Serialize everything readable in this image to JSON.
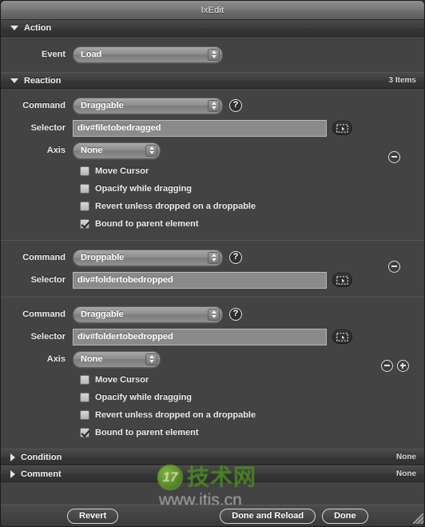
{
  "window": {
    "title": "IxEdit"
  },
  "sections": {
    "action": {
      "title": "Action",
      "disclosure": "down",
      "event_label": "Event",
      "event_value": "Load"
    },
    "reaction": {
      "title": "Reaction",
      "disclosure": "down",
      "count_label": "3 Items",
      "labels": {
        "command": "Command",
        "selector": "Selector",
        "axis": "Axis"
      },
      "items": [
        {
          "command": "Draggable",
          "selector": "div#filetobedragged",
          "axis": "None",
          "checkboxes": [
            {
              "label": "Move Cursor",
              "checked": false
            },
            {
              "label": "Opacify while dragging",
              "checked": false
            },
            {
              "label": "Revert unless dropped on a droppable",
              "checked": false
            },
            {
              "label": "Bound to parent element",
              "checked": true
            }
          ],
          "buttons": [
            "minus"
          ]
        },
        {
          "command": "Droppable",
          "selector": "div#foldertobedropped",
          "axis": null,
          "checkboxes": [],
          "buttons": [
            "minus"
          ]
        },
        {
          "command": "Draggable",
          "selector": "div#foldertobedropped",
          "axis": "None",
          "checkboxes": [
            {
              "label": "Move Cursor",
              "checked": false
            },
            {
              "label": "Opacify while dragging",
              "checked": false
            },
            {
              "label": "Revert unless dropped on a droppable",
              "checked": false
            },
            {
              "label": "Bound to parent element",
              "checked": true
            }
          ],
          "buttons": [
            "minus",
            "plus"
          ]
        }
      ]
    },
    "condition": {
      "title": "Condition",
      "disclosure": "right",
      "value": "None"
    },
    "comment": {
      "title": "Comment",
      "disclosure": "right",
      "value": "None"
    }
  },
  "footer": {
    "revert": "Revert",
    "done_and_reload": "Done and Reload",
    "done": "Done"
  },
  "icons": {
    "help": "?",
    "picker": "element-picker-icon"
  },
  "watermark": {
    "badge": "17",
    "cn_text": "技术网",
    "url": "www.itis.cn"
  },
  "colors": {
    "window_bg": "#434343",
    "section_header": "#383838",
    "field_bg": "#8a8a8a",
    "text": "#ececec"
  }
}
